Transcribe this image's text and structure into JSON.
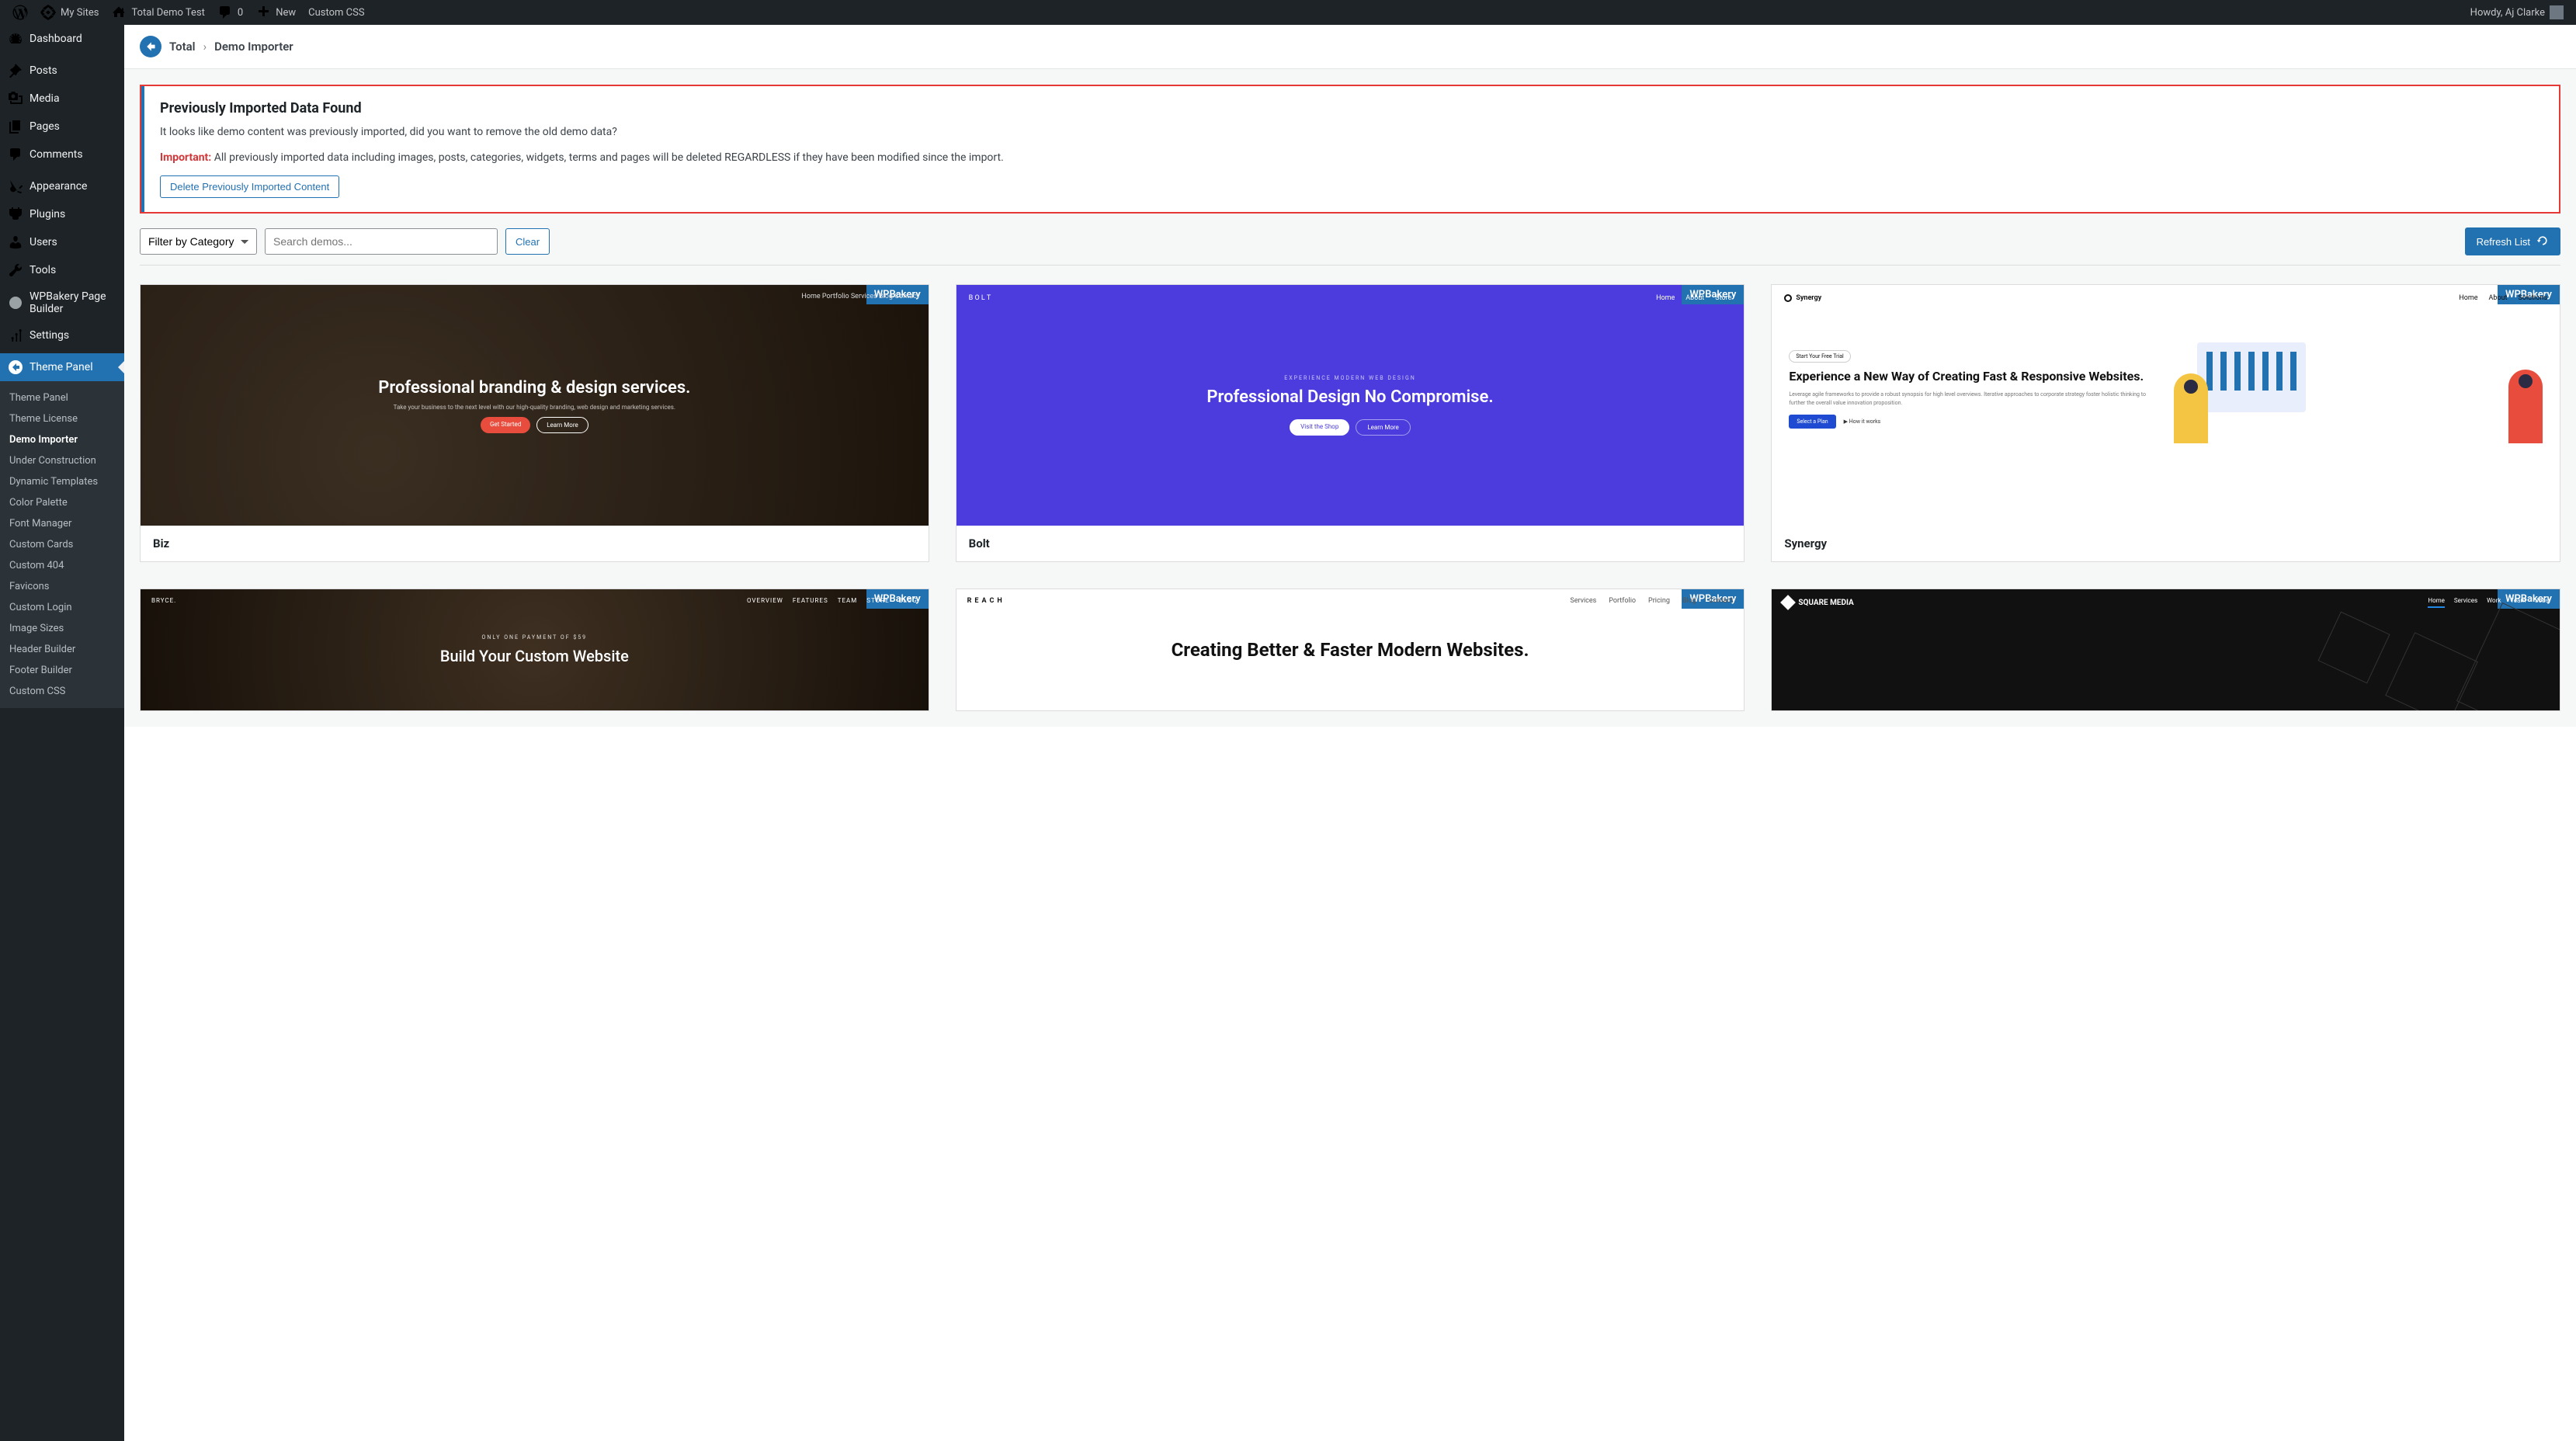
{
  "adminbar": {
    "mysites": "My Sites",
    "sitename": "Total Demo Test",
    "comments": "0",
    "new": "New",
    "customcss": "Custom CSS",
    "greeting": "Howdy, Aj Clarke"
  },
  "sidebar": {
    "dashboard": "Dashboard",
    "posts": "Posts",
    "media": "Media",
    "pages": "Pages",
    "comments": "Comments",
    "appearance": "Appearance",
    "plugins": "Plugins",
    "users": "Users",
    "tools": "Tools",
    "wpbakery": "WPBakery Page Builder",
    "settings": "Settings",
    "themepanel": "Theme Panel"
  },
  "submenu": {
    "themepanel": "Theme Panel",
    "license": "Theme License",
    "demoimporter": "Demo Importer",
    "construction": "Under Construction",
    "dyntemplates": "Dynamic Templates",
    "palette": "Color Palette",
    "fontmgr": "Font Manager",
    "cards": "Custom Cards",
    "custom404": "Custom 404",
    "favicons": "Favicons",
    "customlogin": "Custom Login",
    "imagesizes": "Image Sizes",
    "headerbuilder": "Header Builder",
    "footerbuilder": "Footer Builder",
    "customcss": "Custom CSS"
  },
  "crumbs": {
    "root": "Total",
    "page": "Demo Importer"
  },
  "notice": {
    "title": "Previously Imported Data Found",
    "body": "It looks like demo content was previously imported, did you want to remove the old demo data?",
    "important_label": "Important:",
    "important_text": "All previously imported data including images, posts, categories, widgets, terms and pages will be deleted REGARDLESS if they have been modified since the import.",
    "button": "Delete Previously Imported Content"
  },
  "toolbar": {
    "filter": "Filter by Category",
    "search_placeholder": "Search demos...",
    "clear": "Clear",
    "refresh": "Refresh List"
  },
  "demos": {
    "builder": "WPBakery",
    "biz": {
      "title": "Biz",
      "hero": "Professional branding & design services.",
      "sub": "Take your business to the next level with our high-quality branding, web design and marketing services.",
      "b1": "Get Started",
      "b2": "Learn More",
      "nav": "Home   Portfolio   Services   Blog   Contact"
    },
    "bolt": {
      "title": "Bolt",
      "pre": "EXPERIENCE MODERN WEB DESIGN",
      "hero": "Professional Design No Compromise.",
      "b1": "Visit the Shop",
      "b2": "Learn More",
      "logo": "B O L T",
      "navr1": "Home",
      "navr2": "About",
      "navr3": "Store"
    },
    "synergy": {
      "title": "Synergy",
      "brand": "Synergy",
      "navr1": "Home",
      "navr2": "About",
      "navr3": "Solutions",
      "pill": "Start Your Free Trial",
      "hero": "Experience a New Way of Creating Fast & Responsive Websites.",
      "body": "Leverage agile frameworks to provide a robust synopsis for high level overviews. Iterative approaches to corporate strategy foster holistic thinking to further the overall value innovation proposition.",
      "b1": "Select a Plan",
      "play": "How it works"
    },
    "bryce": {
      "brand": "BRYCE.",
      "price": "ONLY ONE PAYMENT OF $59",
      "hero": "Build Your Custom Website",
      "n1": "OVERVIEW",
      "n2": "FEATURES",
      "n3": "TEAM",
      "n4": "STORE",
      "n5": "BLOG"
    },
    "reach": {
      "brand": "REACH",
      "hero": "Creating Better & Faster Modern Websites.",
      "n1": "Services",
      "n2": "Portfolio",
      "n3": "Pricing",
      "n4": "Blog",
      "n5": "Contact"
    },
    "square": {
      "brand": "SQUARE MEDIA",
      "n1": "Home",
      "n2": "Services",
      "n3": "Work",
      "n4": "Team",
      "n5": "Jobs"
    }
  }
}
